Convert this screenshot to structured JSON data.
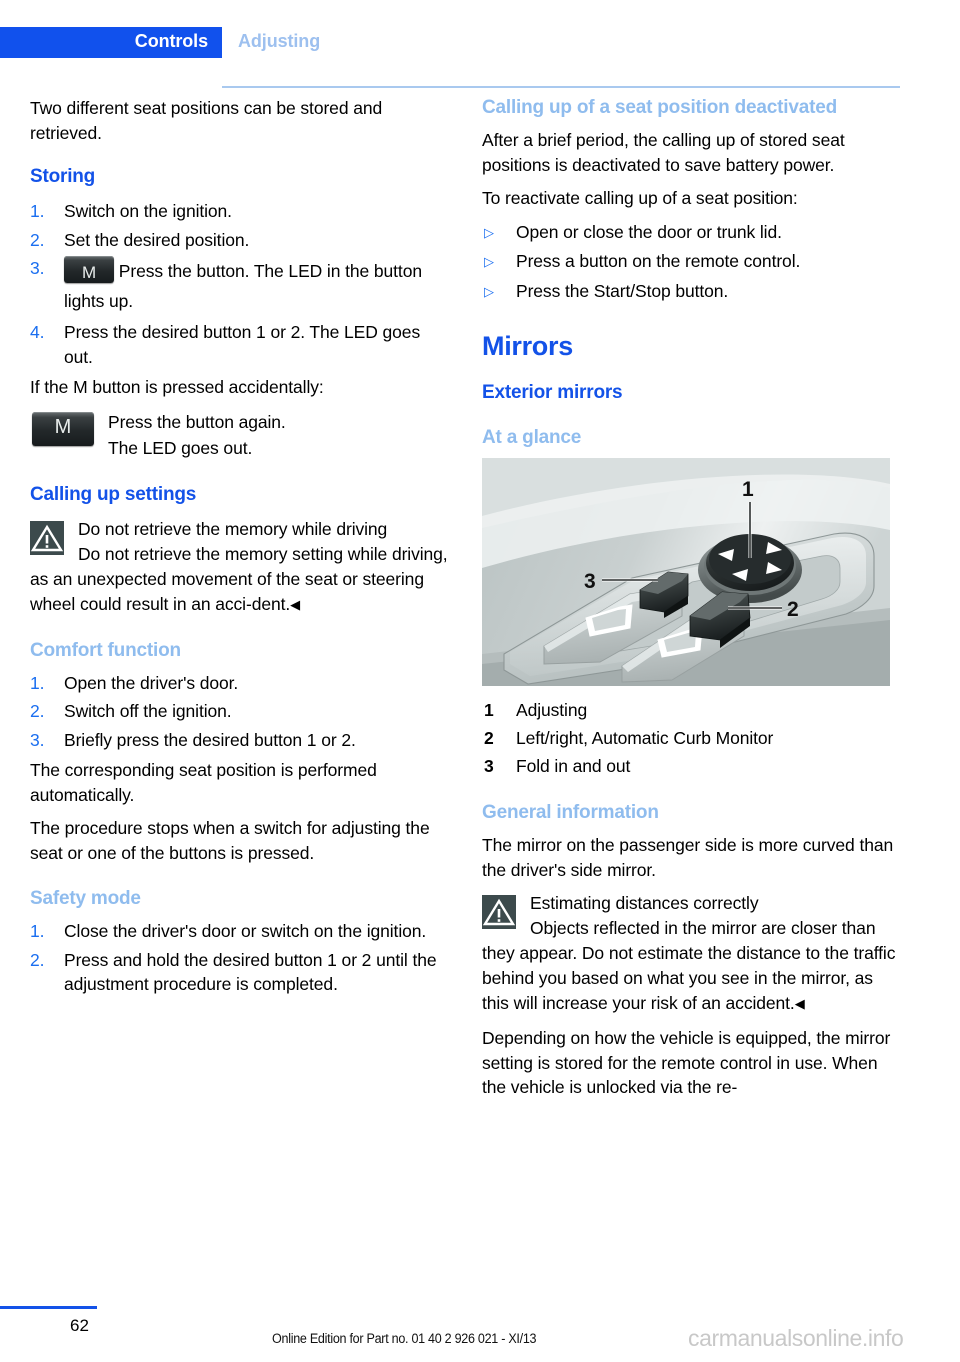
{
  "header": {
    "active_tab": "Controls",
    "secondary_tab": "Adjusting"
  },
  "left_column": {
    "intro": "Two different seat positions can be stored and retrieved.",
    "storing": {
      "heading": "Storing",
      "steps": [
        {
          "num": "1.",
          "text": "Switch on the ignition."
        },
        {
          "num": "2.",
          "text": "Set the desired position."
        },
        {
          "num": "3.",
          "icon": "M",
          "text": "Press the button. The LED in the button lights up."
        },
        {
          "num": "4.",
          "text": "Press the desired button 1 or 2. The LED goes out."
        }
      ],
      "accidental_intro": "If the M button is pressed accidentally:",
      "accidental_icon": "M",
      "accidental_line1": "Press the button again.",
      "accidental_line2": "The LED goes out."
    },
    "calling_up": {
      "heading": "Calling up settings",
      "warning_icon": "warning-triangle-icon",
      "warning_title": "Do not retrieve the memory while driving",
      "warning_body": "Do not retrieve the memory setting while driving, as an unexpected movement of the seat or steering wheel could result in an acci-dent.",
      "warning_end_mark": "◀"
    },
    "comfort": {
      "heading": "Comfort function",
      "steps": [
        {
          "num": "1.",
          "text": "Open the driver's door."
        },
        {
          "num": "2.",
          "text": "Switch off the ignition."
        },
        {
          "num": "3.",
          "text": "Briefly press the desired button 1 or 2."
        }
      ],
      "para1": "The corresponding seat position is performed automatically.",
      "para2": "The procedure stops when a switch for adjusting the seat or one of the buttons is pressed."
    },
    "safety_mode": {
      "heading": "Safety mode",
      "steps": [
        {
          "num": "1.",
          "text": "Close the driver's door or switch on the ignition."
        },
        {
          "num": "2.",
          "text": "Press and hold the desired button 1 or 2 until the adjustment procedure is completed."
        }
      ]
    }
  },
  "right_column": {
    "deactivated": {
      "heading": "Calling up of a seat position deactivated",
      "para1": "After a brief period, the calling up of stored seat positions is deactivated to save battery power.",
      "para2": "To reactivate calling up of a seat position:",
      "bullet_glyph": "▷",
      "bullets": [
        "Open or close the door or trunk lid.",
        "Press a button on the remote control.",
        "Press the Start/Stop button."
      ]
    },
    "mirrors": {
      "heading": "Mirrors",
      "subheading": "Exterior mirrors",
      "at_a_glance": "At a glance",
      "figure_name": "door-panel-mirror-controls-illustration",
      "figure_callouts": [
        "1",
        "2",
        "3"
      ],
      "legend": [
        {
          "num": "1",
          "text": "Adjusting"
        },
        {
          "num": "2",
          "text": "Left/right, Automatic Curb Monitor"
        },
        {
          "num": "3",
          "text": "Fold in and out"
        }
      ]
    },
    "general_information": {
      "heading": "General information",
      "para1": "The mirror on the passenger side is more curved than the driver's side mirror.",
      "warning_icon": "warning-triangle-icon",
      "warning_title": "Estimating distances correctly",
      "warning_body": "Objects reflected in the mirror are closer than they appear. Do not estimate the distance to the traffic behind you based on what you see in the mirror, as this will increase your risk of an accident.",
      "warning_end_mark": "◀",
      "para2": "Depending on how the vehicle is equipped, the mirror setting is stored for the remote control in use. When the vehicle is unlocked via the re-"
    }
  },
  "footer": {
    "page_number": "62",
    "edition_note": "Online Edition for Part no. 01 40 2 926 021 - XI/13",
    "watermark": "carmanualsonline.info"
  },
  "colors": {
    "accent_blue": "#1151ed",
    "heading_blue": "#1352e8",
    "light_blue": "#8fbcee",
    "list_blue": "#1a6ef0",
    "warn_icon_bg": "#3c4a4c"
  }
}
